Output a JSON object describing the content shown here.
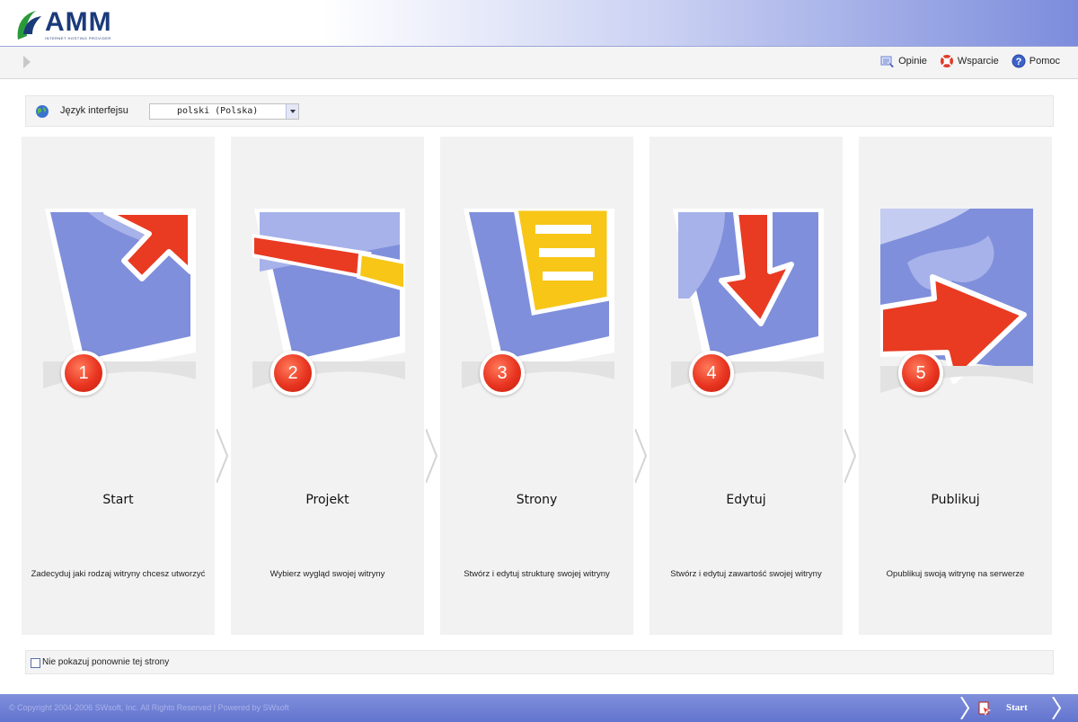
{
  "header": {
    "logo_text": "AMM",
    "logo_subtitle": "INTERNET HOSTING PROVIDER"
  },
  "toolbar": {
    "links": [
      {
        "label": "Opinie",
        "icon": "feedback-icon"
      },
      {
        "label": "Wsparcie",
        "icon": "support-icon"
      },
      {
        "label": "Pomoc",
        "icon": "help-icon"
      }
    ]
  },
  "language": {
    "label": "Język interfejsu",
    "selected": "polski (Polska)"
  },
  "steps": [
    {
      "number": "1",
      "title": "Start",
      "description": "Zadecyduj jaki rodzaj witryny chcesz utworzyć",
      "icon": "arrow-cursor-icon"
    },
    {
      "number": "2",
      "title": "Projekt",
      "description": "Wybierz wygląd swojej witryny",
      "icon": "pencil-icon"
    },
    {
      "number": "3",
      "title": "Strony",
      "description": "Stwórz i edytuj strukturę swojej witryny",
      "icon": "page-list-icon"
    },
    {
      "number": "4",
      "title": "Edytuj",
      "description": "Stwórz i edytuj zawartość swojej witryny",
      "icon": "down-arrow-icon"
    },
    {
      "number": "5",
      "title": "Publikuj",
      "description": "Opublikuj swoją witrynę na serwerze",
      "icon": "globe-arrow-icon"
    }
  ],
  "footer": {
    "checkbox_label": "Nie pokazuj ponownie tej strony",
    "checkbox_checked": false,
    "copyright": "© Copyright 2004-2006 SWsoft, Inc. All Rights Reserved  |  Powered by  SWsoft",
    "start_label": "Start"
  },
  "colors": {
    "accent_blue": "#7c8cdc",
    "panel_bg": "#f2f2f2",
    "step_red": "#e83420",
    "illus_blue": "#7f8fdb",
    "illus_yellow": "#f7c617"
  }
}
